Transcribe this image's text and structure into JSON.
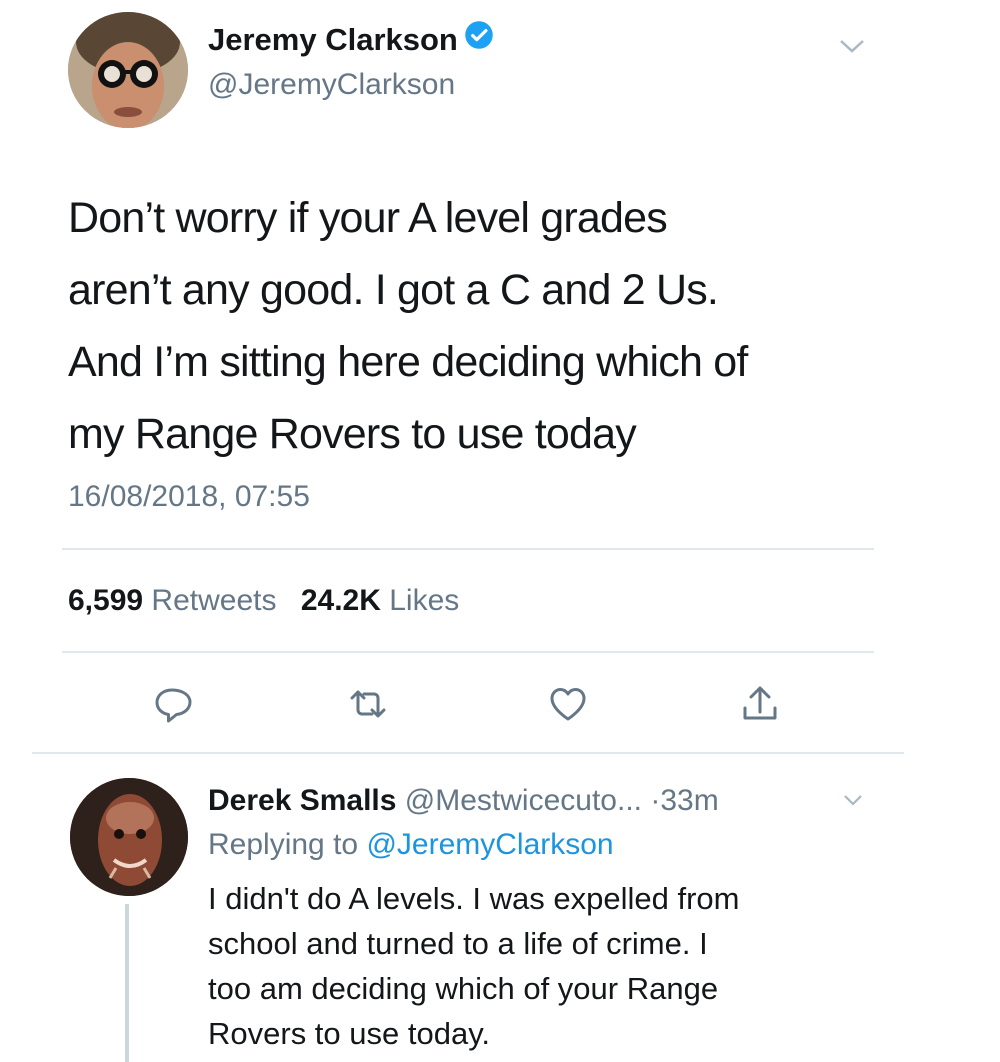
{
  "tweet": {
    "author_name": "Jeremy Clarkson",
    "author_handle": "@JeremyClarkson",
    "verified": true,
    "lines": [
      "Don’t worry if your A level grades",
      "aren’t any good. I got a C and 2 Us.",
      "And I’m sitting here deciding which of",
      "my Range Rovers to use today"
    ],
    "timestamp": "16/08/2018, 07:55",
    "retweets_count": "6,599",
    "retweets_label": "Retweets",
    "likes_count": "24.2K",
    "likes_label": "Likes"
  },
  "actions": {
    "reply_icon": "reply-icon",
    "retweet_icon": "retweet-icon",
    "like_icon": "heart-icon",
    "share_icon": "share-icon"
  },
  "reply": {
    "author_name": "Derek Smalls",
    "author_handle": "@Mestwicecuto...",
    "separator": "·",
    "time": "33m",
    "replying_prefix": "Replying to",
    "replying_to": "@JeremyClarkson",
    "lines": [
      "I didn't do A levels. I was expelled from",
      "school and turned to a life of crime. I",
      "too am deciding which of your Range",
      "Rovers to use today."
    ]
  },
  "colors": {
    "text": "#14171a",
    "secondary": "#657786",
    "accent": "#1b95e0",
    "divider": "#e1e8ed"
  }
}
